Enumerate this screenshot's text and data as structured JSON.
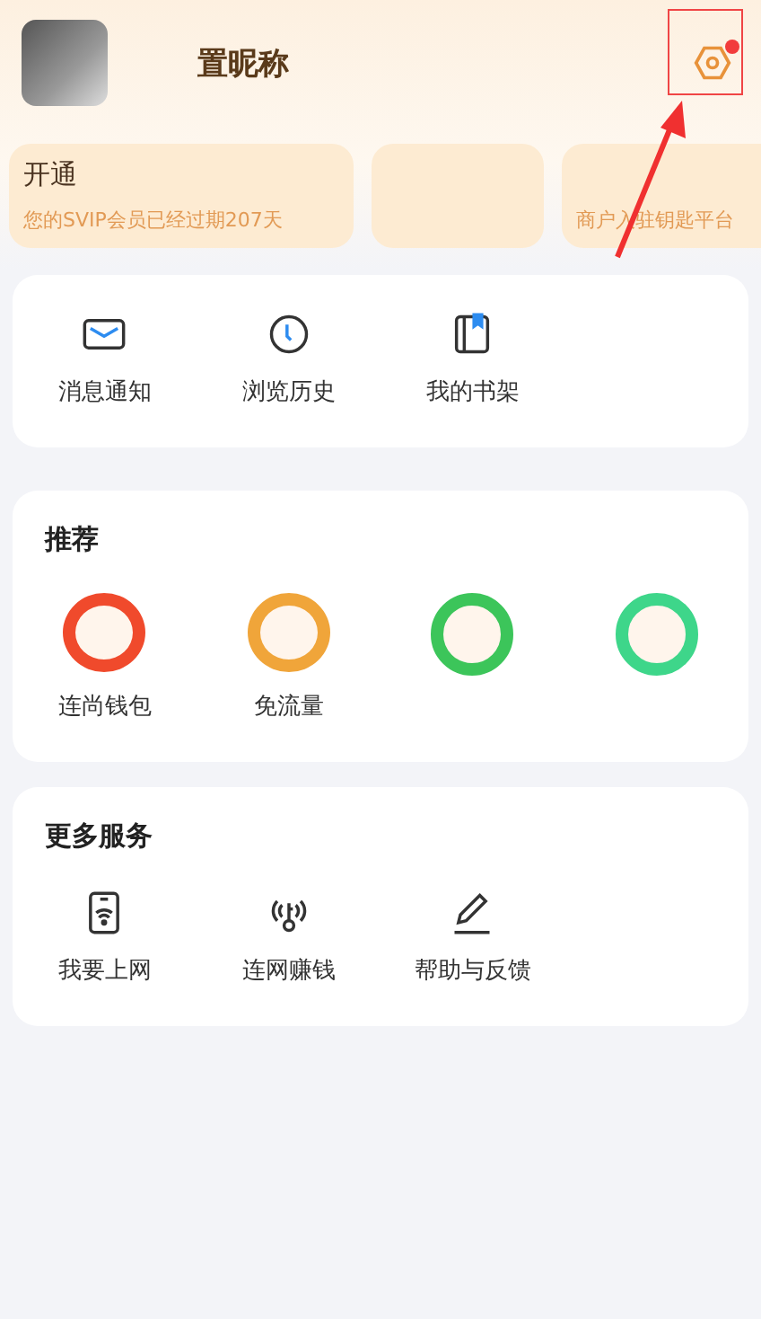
{
  "profile": {
    "nickname": "置昵称",
    "settings_badge": true
  },
  "promo_cards": [
    {
      "kind": "text",
      "title": "开通",
      "subtitle": "您的SVIP会员已经过期207天"
    },
    {
      "kind": "blank"
    },
    {
      "kind": "text",
      "subtitle": "商户入驻钥匙平台"
    }
  ],
  "shortcuts": [
    {
      "kind": "mail",
      "label": "消息通知"
    },
    {
      "kind": "clock",
      "label": "浏览历史"
    },
    {
      "kind": "book",
      "label": "我的书架"
    }
  ],
  "recommend": {
    "title": "推荐",
    "items": [
      {
        "color": "#f04a2c",
        "label": "连尚钱包"
      },
      {
        "color": "#f0a53a",
        "label": "免流量"
      },
      {
        "color": "#3cc55a"
      },
      {
        "color": "#3ed68a"
      }
    ]
  },
  "services": {
    "title": "更多服务",
    "items": [
      {
        "kind": "wifi",
        "label": "我要上网"
      },
      {
        "kind": "key",
        "label": "连网赚钱"
      },
      {
        "kind": "pen",
        "label": "帮助与反馈"
      }
    ]
  },
  "annotation": {
    "highlight": true
  }
}
